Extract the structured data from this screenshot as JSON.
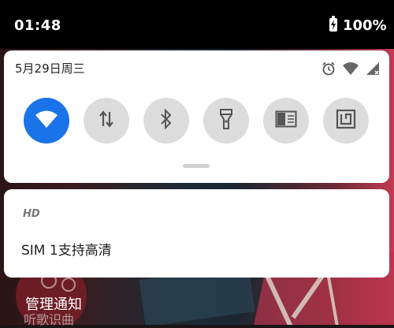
{
  "status_bar": {
    "time": "01:48",
    "battery_percent": "100%",
    "battery_level": 100
  },
  "quick_settings": {
    "date": "5月29日周三",
    "status_icons": [
      "alarm-icon",
      "wifi-icon",
      "cell-signal-icon"
    ],
    "tiles": [
      {
        "name": "wifi",
        "icon": "wifi-icon",
        "active": true
      },
      {
        "name": "mobile-data",
        "icon": "data-arrows-icon",
        "active": false
      },
      {
        "name": "bluetooth",
        "icon": "bluetooth-icon",
        "active": false
      },
      {
        "name": "flashlight",
        "icon": "flashlight-icon",
        "active": false
      },
      {
        "name": "reading-mode",
        "icon": "reading-mode-icon",
        "active": false
      },
      {
        "name": "nfc",
        "icon": "nfc-icon",
        "active": false
      }
    ]
  },
  "notification": {
    "app": "HD",
    "text": "SIM 1支持高清"
  },
  "manage_label": "管理通知",
  "background_text": "听歌识曲",
  "colors": {
    "accent": "#1a73e8",
    "tile_inactive": "#dcdcdc",
    "status_bar": "#000000"
  }
}
